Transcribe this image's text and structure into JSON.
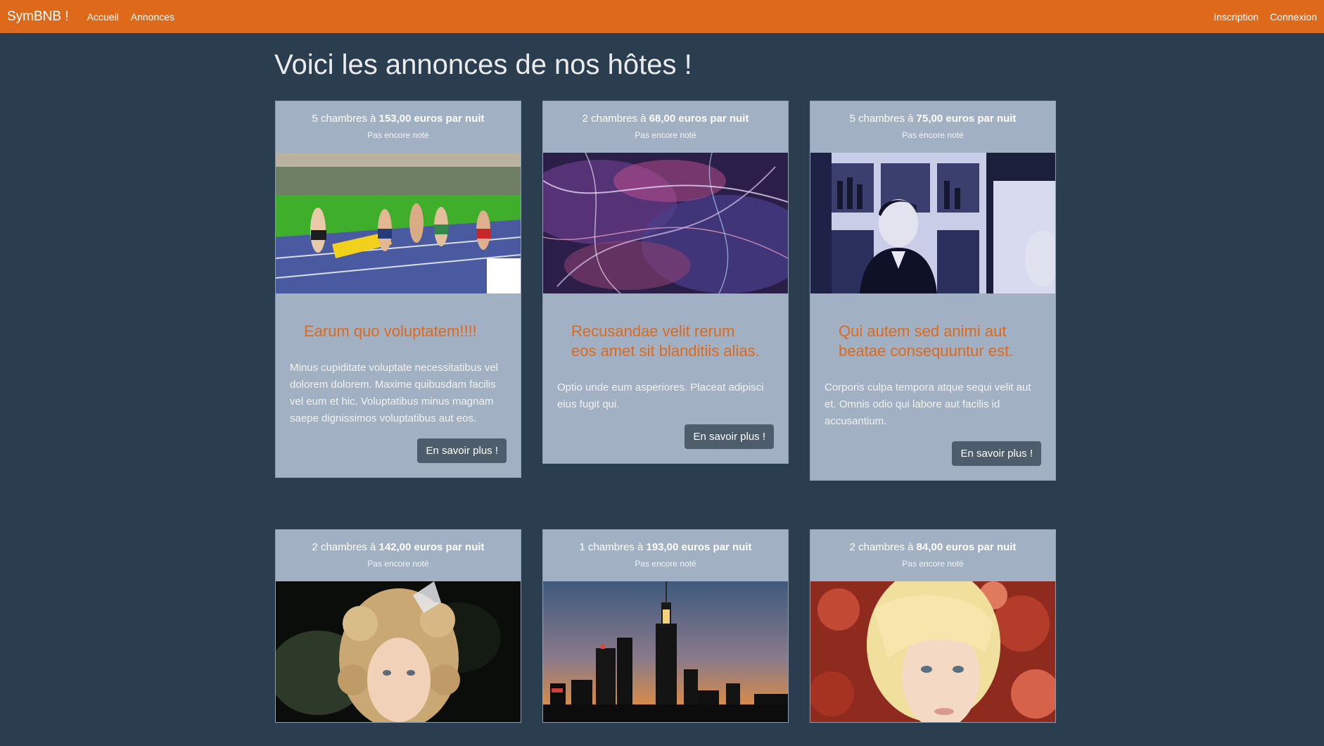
{
  "navbar": {
    "brand": "SymBNB !",
    "links": [
      "Accueil",
      "Annonces"
    ],
    "right_links": [
      "Inscription",
      "Connexion"
    ],
    "color": "#df691a"
  },
  "page": {
    "title": "Voici les annonces de nos hôtes !"
  },
  "ads": [
    {
      "rooms_text": "5 chambres à ",
      "price_text": "153,00 euros par nuit",
      "rating": "Pas encore noté",
      "image": "athletics-race-photo",
      "title": "Earum quo voluptatem!!!!",
      "text": "Minus cupiditate voluptate necessitatibus vel dolorem dolorem. Maxime quibusdam facilis vel eum et hic. Voluptatibus minus magnam saepe dignissimos voluptatibus aut eos.",
      "button": "En savoir plus !"
    },
    {
      "rooms_text": "2 chambres à ",
      "price_text": "68,00 euros par nuit",
      "rating": "Pas encore noté",
      "image": "abstract-art-photo",
      "title": "Recusandae velit rerum eos amet sit blanditiis alias.",
      "text": "Optio unde eum asperiores. Placeat adipisci eius fugit qui.",
      "button": "En savoir plus !"
    },
    {
      "rooms_text": "5 chambres à ",
      "price_text": "75,00 euros par nuit",
      "rating": "Pas encore noté",
      "image": "bar-man-photo",
      "title": "Qui autem sed animi aut beatae consequuntur est.",
      "text": "Corporis culpa tempora atque sequi velit aut et. Omnis odio qui labore aut facilis id accusantium.",
      "button": "En savoir plus !"
    },
    {
      "rooms_text": "2 chambres à ",
      "price_text": "142,00 euros par nuit",
      "rating": "Pas encore noté",
      "image": "curly-girl-photo"
    },
    {
      "rooms_text": "1 chambres à ",
      "price_text": "193,00 euros par nuit",
      "rating": "Pas encore noté",
      "image": "city-skyline-photo"
    },
    {
      "rooms_text": "2 chambres à ",
      "price_text": "84,00 euros par nuit",
      "rating": "Pas encore noté",
      "image": "blonde-woman-photo"
    }
  ]
}
